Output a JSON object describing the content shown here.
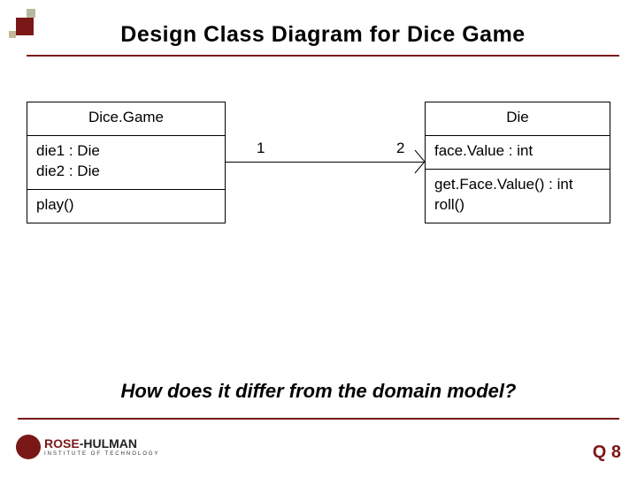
{
  "title": "Design Class Diagram for Dice Game",
  "classLeft": {
    "name": "Dice.Game",
    "attr1": "die1 : Die",
    "attr2": "die2 : Die",
    "op1": "play()"
  },
  "classRight": {
    "name": "Die",
    "attr1": "face.Value : int",
    "op1": "get.Face.Value() : int",
    "op2": "roll()"
  },
  "assoc": {
    "multLeft": "1",
    "multRight": "2"
  },
  "question": "How does it differ from the domain model?",
  "footer": {
    "logoRose": "ROSE",
    "logoHulman": "-HULMAN",
    "logoSub": "INSTITUTE OF TECHNOLOGY",
    "qnum": "Q 8"
  },
  "chart_data": {
    "type": "table",
    "title": "Design Class Diagram for Dice Game",
    "classes": [
      {
        "name": "DiceGame",
        "attributes": [
          "die1 : Die",
          "die2 : Die"
        ],
        "operations": [
          "play()"
        ]
      },
      {
        "name": "Die",
        "attributes": [
          "faceValue : int"
        ],
        "operations": [
          "getFaceValue() : int",
          "roll()"
        ]
      }
    ],
    "associations": [
      {
        "from": "DiceGame",
        "to": "Die",
        "fromMultiplicity": "1",
        "toMultiplicity": "2",
        "navigability": "to"
      }
    ]
  }
}
